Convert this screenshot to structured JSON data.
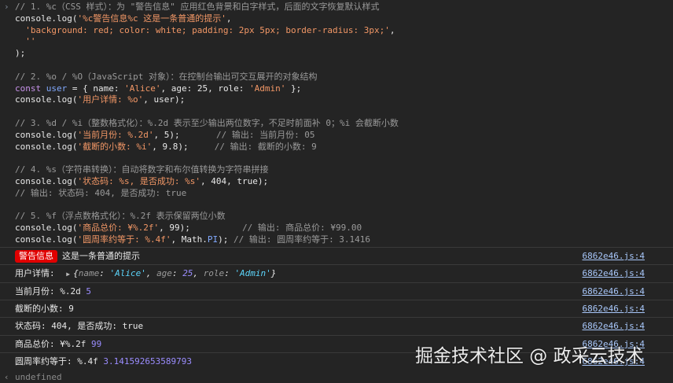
{
  "code": {
    "prompt_icon": "chevron-right-icon",
    "lines": [
      {
        "y": 0,
        "parts": [
          [
            "cmt",
            "// 1. %c（CSS 样式）：为 \"警告信息\" 应用红色背景和白字样式，后面的文字恢复默认样式"
          ]
        ]
      },
      {
        "y": 1,
        "parts": [
          [
            "pln",
            "console.log("
          ],
          [
            "str",
            "'%c警告信息%c 这是一条普通的提示'"
          ],
          [
            "pln",
            ","
          ]
        ]
      },
      {
        "y": 2,
        "parts": [
          [
            "pln",
            "  "
          ],
          [
            "str",
            "'background: red; color: white; padding: 2px 5px; border-radius: 3px;'"
          ],
          [
            "pln",
            ","
          ]
        ]
      },
      {
        "y": 3,
        "parts": [
          [
            "pln",
            "  "
          ],
          [
            "str",
            "''"
          ]
        ]
      },
      {
        "y": 4,
        "parts": [
          [
            "pln",
            ");"
          ]
        ]
      },
      {
        "y": 6,
        "parts": [
          [
            "cmt",
            "// 2. %o / %O（JavaScript 对象）：在控制台输出可交互展开的对象结构"
          ]
        ]
      },
      {
        "y": 7,
        "parts": [
          [
            "kw",
            "const"
          ],
          [
            "pln",
            " "
          ],
          [
            "var",
            "user"
          ],
          [
            "pln",
            " = { name: "
          ],
          [
            "str",
            "'Alice'"
          ],
          [
            "pln",
            ", age: 25, role: "
          ],
          [
            "str",
            "'Admin'"
          ],
          [
            "pln",
            " };"
          ]
        ]
      },
      {
        "y": 8,
        "parts": [
          [
            "pln",
            "console.log("
          ],
          [
            "str",
            "'用户详情: %o'"
          ],
          [
            "pln",
            ", user);"
          ]
        ]
      },
      {
        "y": 10,
        "parts": [
          [
            "cmt",
            "// 3. %d / %i（整数格式化）：%.2d 表示至少输出两位数字，不足时前面补 0；%i 会截断小数"
          ]
        ]
      },
      {
        "y": 11,
        "parts": [
          [
            "pln",
            "console.log("
          ],
          [
            "str",
            "'当前月份: %.2d'"
          ],
          [
            "pln",
            ", 5);       "
          ],
          [
            "cmt",
            "// 输出: 当前月份: 05"
          ]
        ]
      },
      {
        "y": 12,
        "parts": [
          [
            "pln",
            "console.log("
          ],
          [
            "str",
            "'截断的小数: %i'"
          ],
          [
            "pln",
            ", 9.8);     "
          ],
          [
            "cmt",
            "// 输出: 截断的小数: 9"
          ]
        ]
      },
      {
        "y": 14,
        "parts": [
          [
            "cmt",
            "// 4. %s（字符串转换）：自动将数字和布尔值转换为字符串拼接"
          ]
        ]
      },
      {
        "y": 15,
        "parts": [
          [
            "pln",
            "console.log("
          ],
          [
            "str",
            "'状态码: %s, 是否成功: %s'"
          ],
          [
            "pln",
            ", 404, true);"
          ]
        ]
      },
      {
        "y": 16,
        "parts": [
          [
            "cmt",
            "// 输出: 状态码: 404, 是否成功: true"
          ]
        ]
      },
      {
        "y": 18,
        "parts": [
          [
            "cmt",
            "// 5. %f（浮点数格式化）：%.2f 表示保留两位小数"
          ]
        ]
      },
      {
        "y": 19,
        "parts": [
          [
            "pln",
            "console.log("
          ],
          [
            "str",
            "'商品总价: ¥%.2f'"
          ],
          [
            "pln",
            ", 99);          "
          ],
          [
            "cmt",
            "// 输出: 商品总价: ¥99.00"
          ]
        ]
      },
      {
        "y": 20,
        "parts": [
          [
            "pln",
            "console.log("
          ],
          [
            "str",
            "'圆周率约等于: %.4f'"
          ],
          [
            "pln",
            ", Math."
          ],
          [
            "var",
            "PI"
          ],
          [
            "pln",
            "); "
          ],
          [
            "cmt",
            "// 输出: 圆周率约等于: 3.1416"
          ]
        ]
      }
    ]
  },
  "output": {
    "source_link": "6862e46.js:4",
    "rows": [
      {
        "kind": "styled",
        "badge": "警告信息",
        "text": "这是一条普通的提示"
      },
      {
        "kind": "object",
        "label": "用户详情: ",
        "obj": {
          "open": "{",
          "close": "}",
          "props": [
            [
              "name",
              "'Alice'",
              "str"
            ],
            [
              "age",
              "25",
              "num"
            ],
            [
              "role",
              "'Admin'",
              "str"
            ]
          ]
        }
      },
      {
        "kind": "text",
        "text": "当前月份: %.2d ",
        "value": "5"
      },
      {
        "kind": "text",
        "text": "截断的小数: 9",
        "value": ""
      },
      {
        "kind": "text",
        "text": "状态码: 404, 是否成功: true",
        "value": ""
      },
      {
        "kind": "text",
        "text": "商品总价: ¥%.2f ",
        "value": "99"
      },
      {
        "kind": "text",
        "text": "圆周率约等于: %.4f ",
        "value": "3.141592653589793"
      }
    ],
    "undefined_text": "undefined"
  },
  "watermark": "掘金技术社区 @ 政采云技术"
}
